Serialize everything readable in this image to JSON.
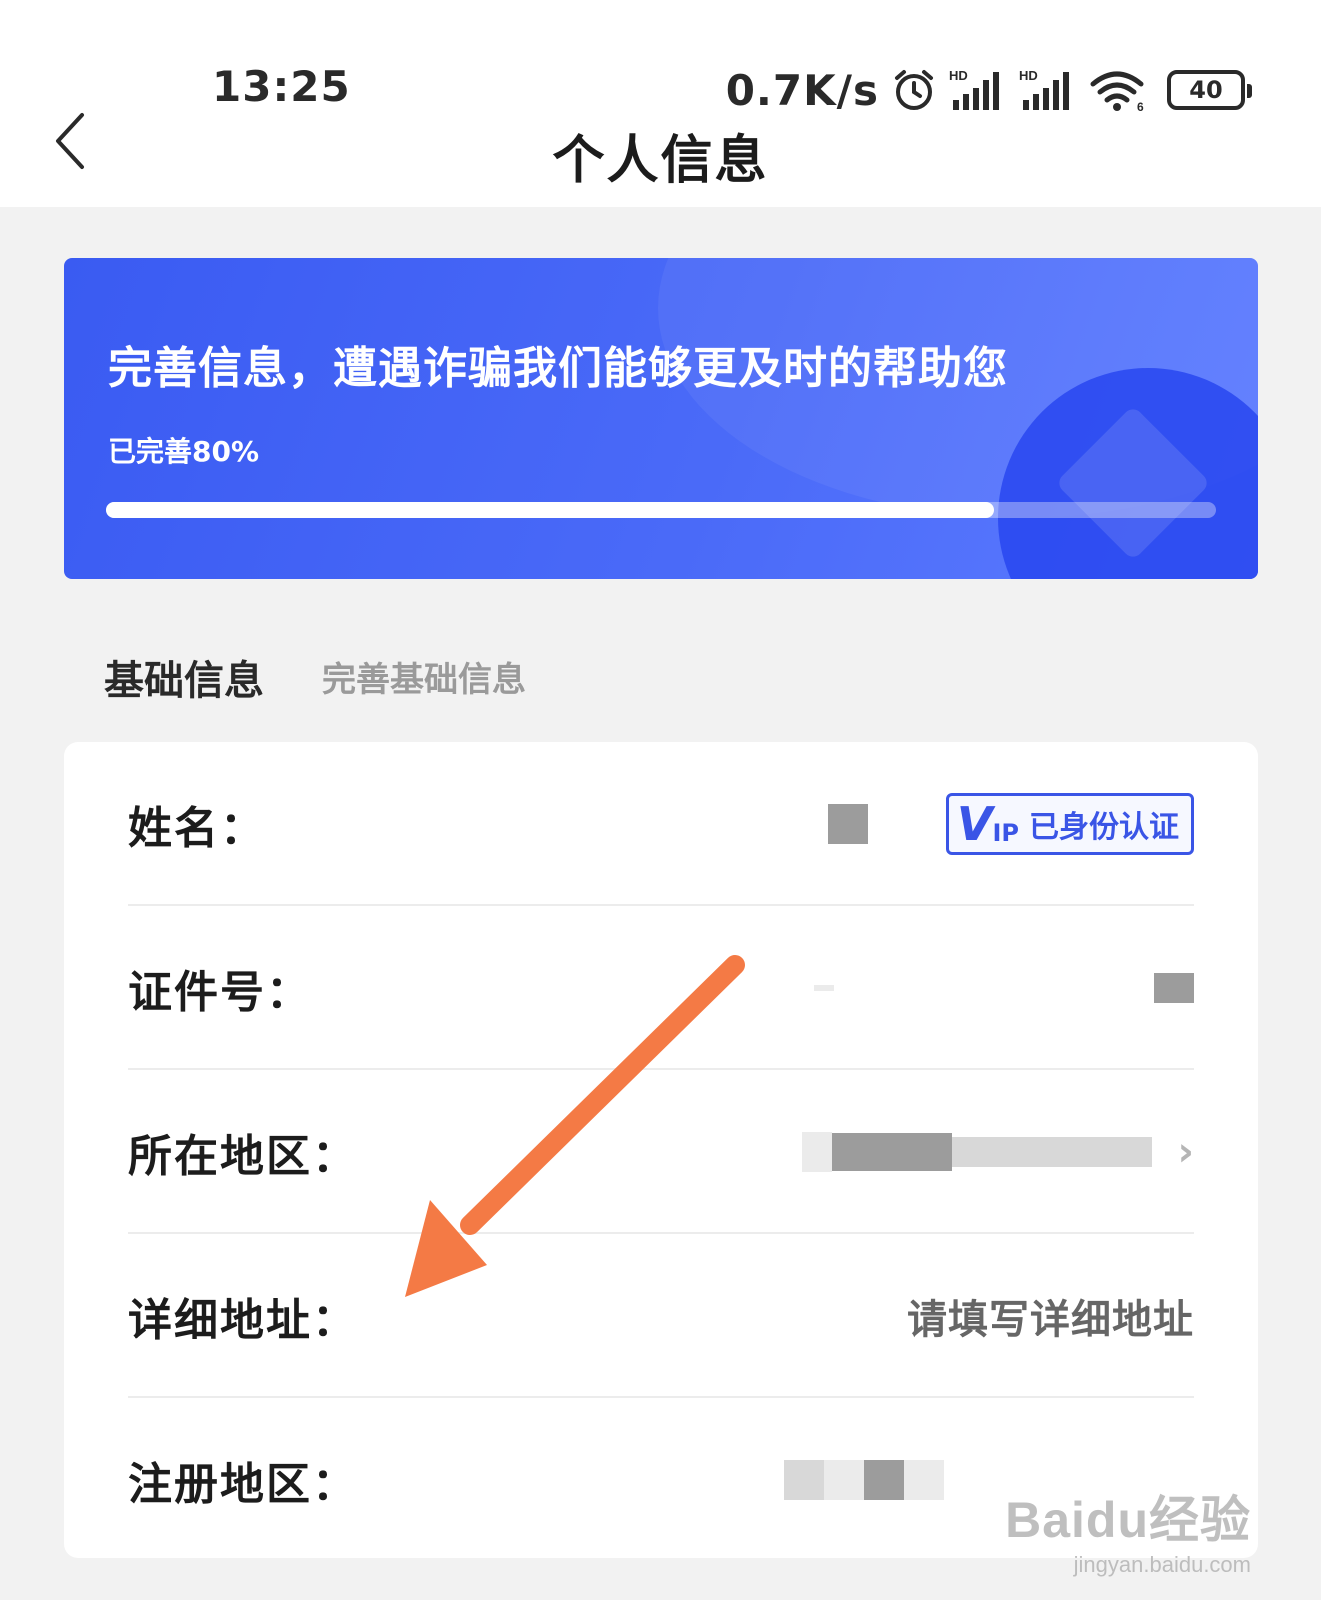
{
  "status_bar": {
    "time": "13:25",
    "net_speed": "0.7K/s",
    "battery": "40",
    "icons": [
      "alarm-icon",
      "signal-hd-icon",
      "signal-hd-icon",
      "wifi-icon",
      "battery-icon"
    ]
  },
  "header": {
    "title": "个人信息",
    "back_icon": "chevron-left-icon"
  },
  "banner": {
    "title": "完善信息，遭遇诈骗我们能够更及时的帮助您",
    "progress_label": "已完善80%",
    "progress": 0.8
  },
  "section": {
    "title": "基础信息",
    "subtitle": "完善基础信息"
  },
  "fields": [
    {
      "label": "姓名：",
      "badge": {
        "logo": "VIP",
        "text": "已身份认证"
      }
    },
    {
      "label": "证件号："
    },
    {
      "label": "所在地区："
    },
    {
      "label": "详细地址：",
      "placeholder": "请填写详细地址"
    },
    {
      "label": "注册地区："
    }
  ],
  "watermark": {
    "brand": "Baidu经验",
    "url": "jingyan.baidu.com"
  },
  "colors": {
    "accent": "#3a55e6",
    "banner": "#4a6af8",
    "annotation_arrow": "#f47a45"
  }
}
